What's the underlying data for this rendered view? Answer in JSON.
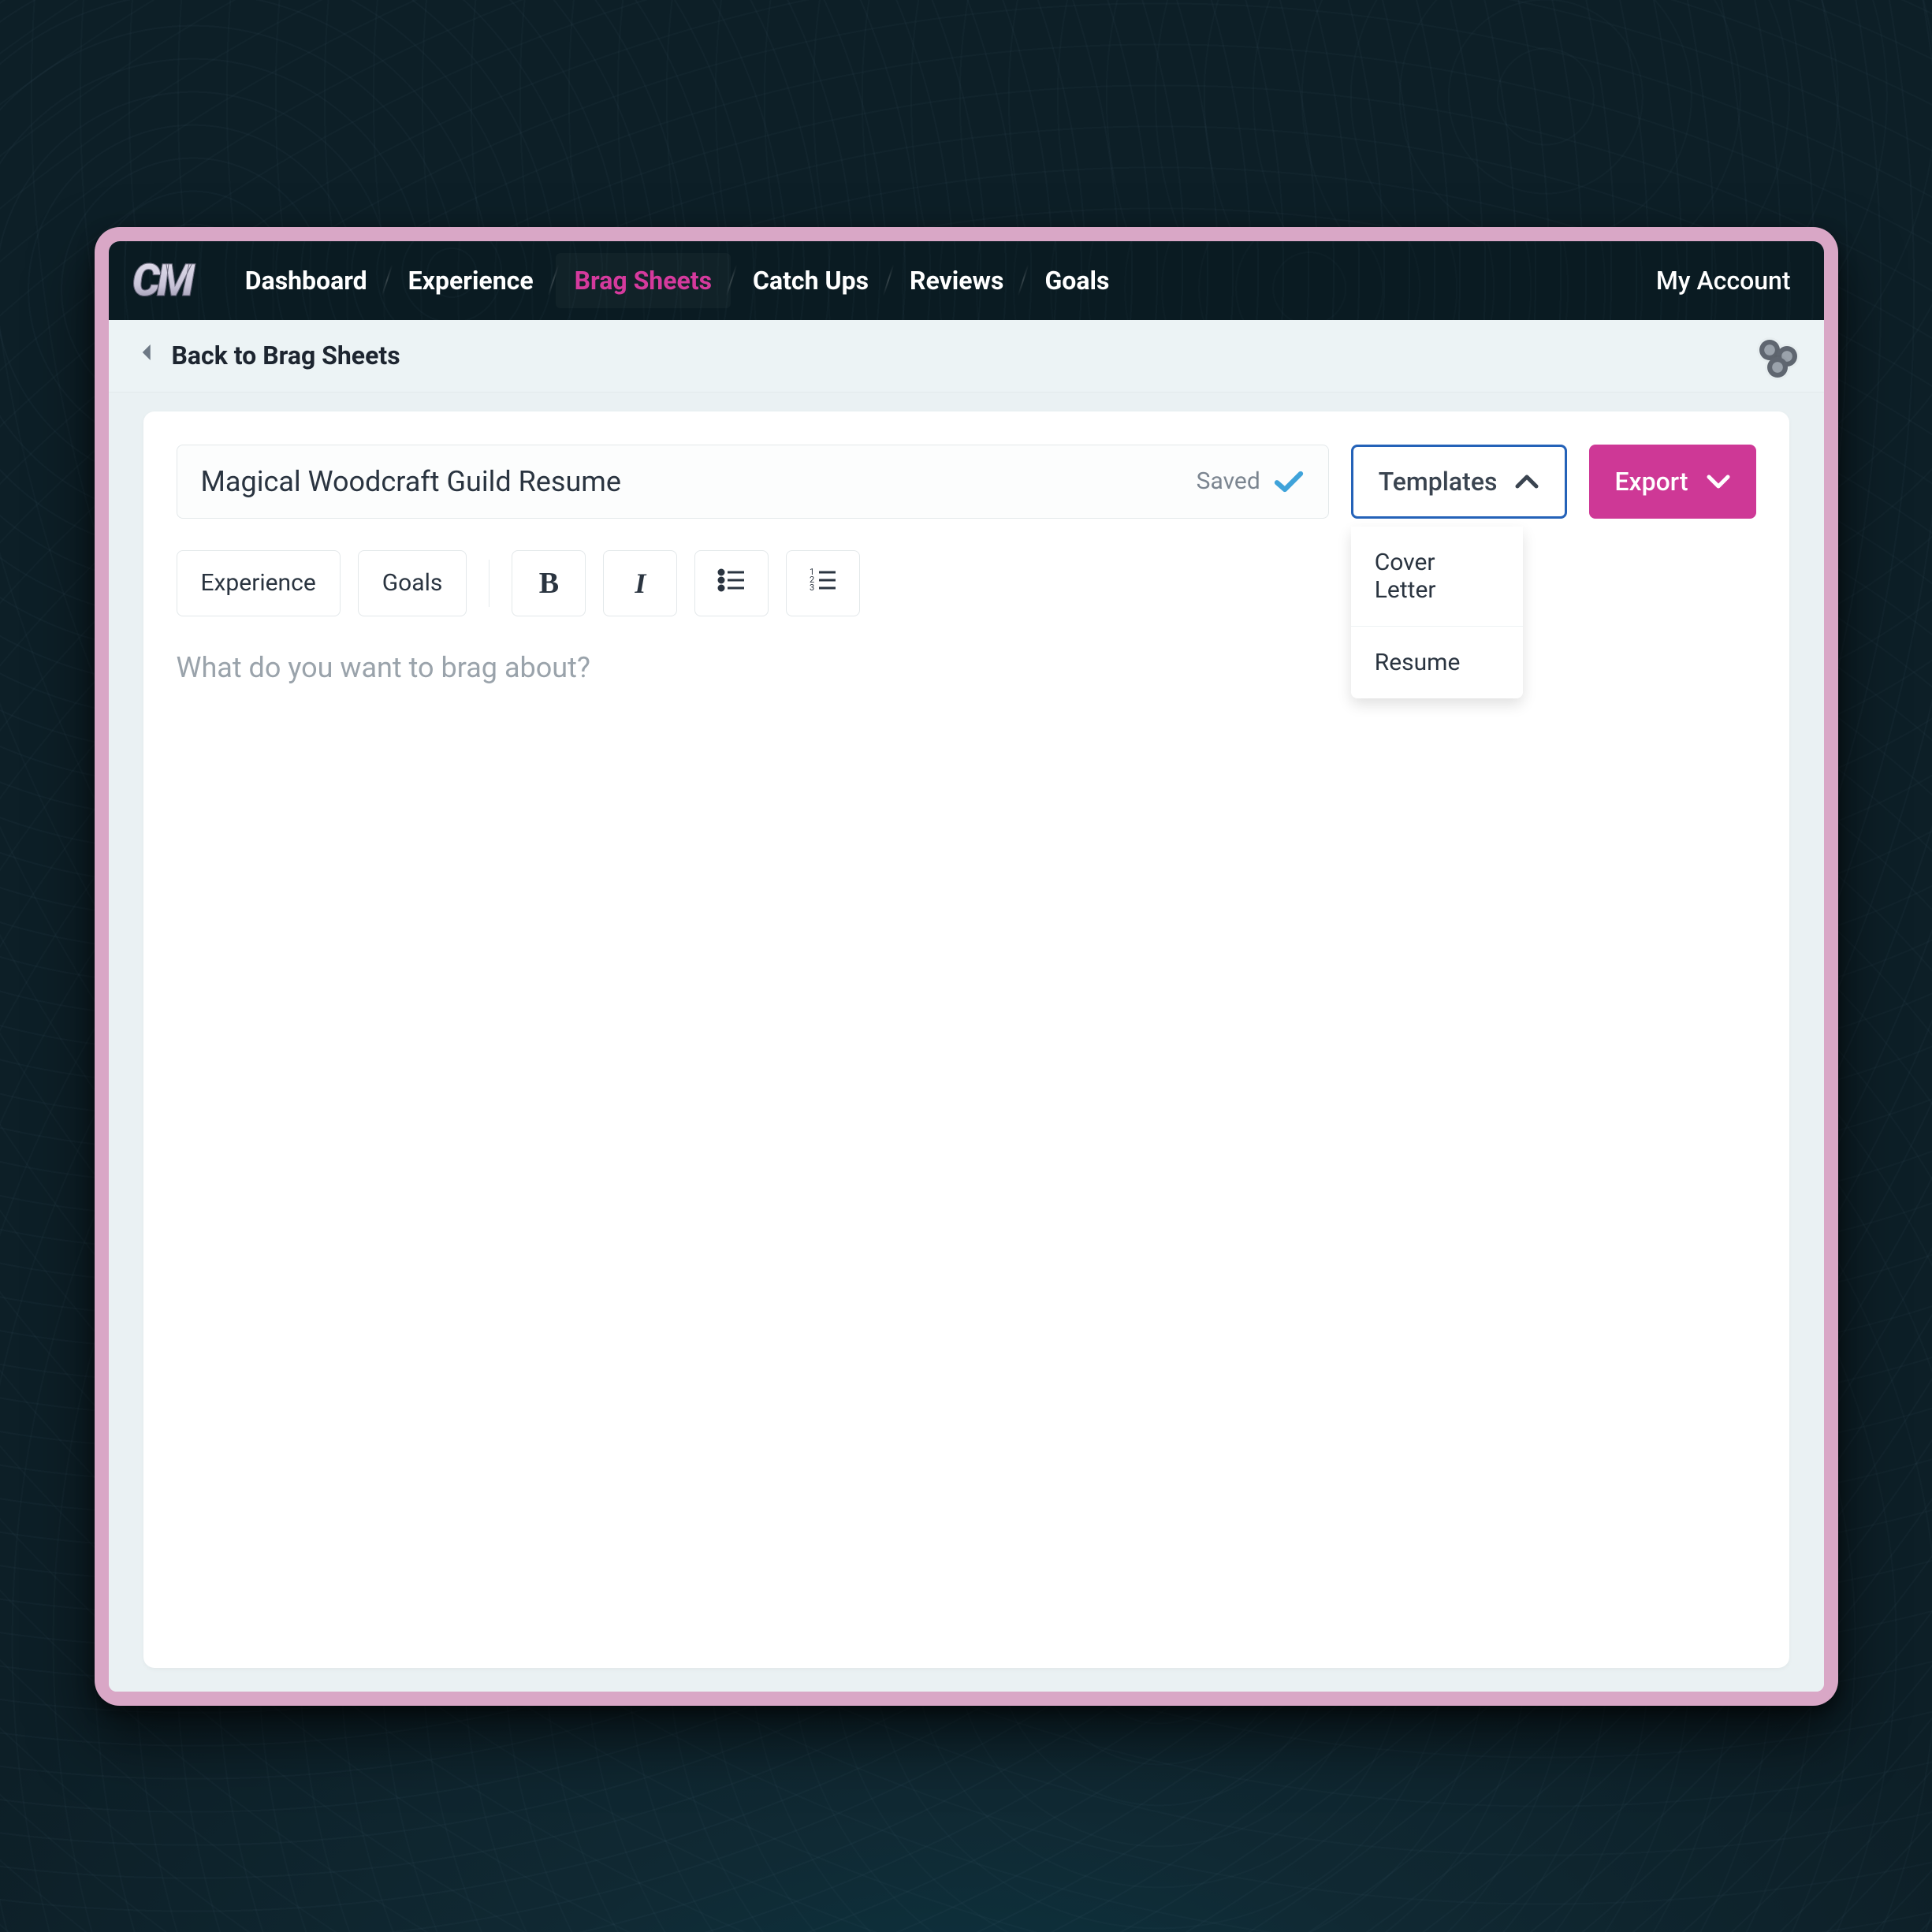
{
  "nav": {
    "logo": "CM",
    "items": [
      "Dashboard",
      "Experience",
      "Brag Sheets",
      "Catch Ups",
      "Reviews",
      "Goals"
    ],
    "active_index": 2,
    "account": "My Account"
  },
  "subheader": {
    "back_label": "Back to Brag Sheets"
  },
  "document": {
    "title": "Magical Woodcraft Guild Resume",
    "save_status": "Saved"
  },
  "buttons": {
    "templates": "Templates",
    "export": "Export"
  },
  "templates_menu": [
    "Cover Letter",
    "Resume"
  ],
  "toolbar": {
    "experience": "Experience",
    "goals": "Goals"
  },
  "editor": {
    "placeholder": "What do you want to brag about?"
  }
}
